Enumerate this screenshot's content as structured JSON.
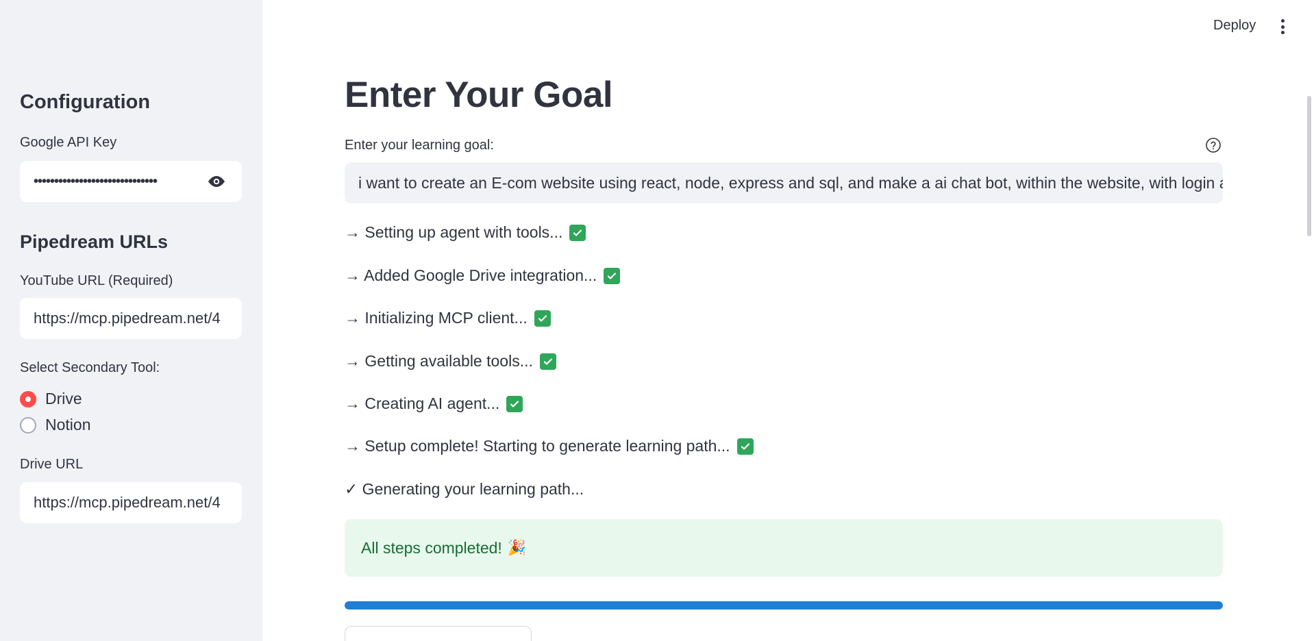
{
  "topbar": {
    "deploy_label": "Deploy",
    "menu_icon": "kebab-menu-icon"
  },
  "sidebar": {
    "config_heading": "Configuration",
    "api_key_label": "Google API Key",
    "api_key_value": "••••••••••••••••••••••••••••••",
    "api_key_icon": "eye-icon",
    "pipedream_heading": "Pipedream URLs",
    "youtube_label": "YouTube URL (Required)",
    "youtube_value": "https://mcp.pipedream.net/4",
    "secondary_label": "Select Secondary Tool:",
    "options": [
      {
        "label": "Drive",
        "selected": true
      },
      {
        "label": "Notion",
        "selected": false
      }
    ],
    "drive_label": "Drive URL",
    "drive_value": "https://mcp.pipedream.net/4"
  },
  "main": {
    "title": "Enter Your Goal",
    "goal_label": "Enter your learning goal:",
    "goal_value": "i want to create an E-com website using react, node, express and sql, and make a ai chat bot, within the website, with login an",
    "steps": [
      {
        "text": "→ Setting up agent with tools...",
        "done": true
      },
      {
        "text": "→ Added Google Drive integration...",
        "done": true
      },
      {
        "text": "→ Initializing MCP client...",
        "done": true
      },
      {
        "text": "→ Getting available tools...",
        "done": true
      },
      {
        "text": "→ Creating AI agent...",
        "done": true
      },
      {
        "text": "→ Setup complete! Starting to generate learning path...",
        "done": true
      },
      {
        "text": "✓ Generating your learning path...",
        "done": false
      }
    ],
    "success_message": "All steps completed!",
    "success_emoji": "🎉",
    "progress_fraction": 1.0
  },
  "colors": {
    "accent": "#ff4b4b",
    "progress": "#1f7fd4",
    "success_bg": "#e8f8ec",
    "success_text": "#176c36",
    "check": "#2fa65a"
  }
}
